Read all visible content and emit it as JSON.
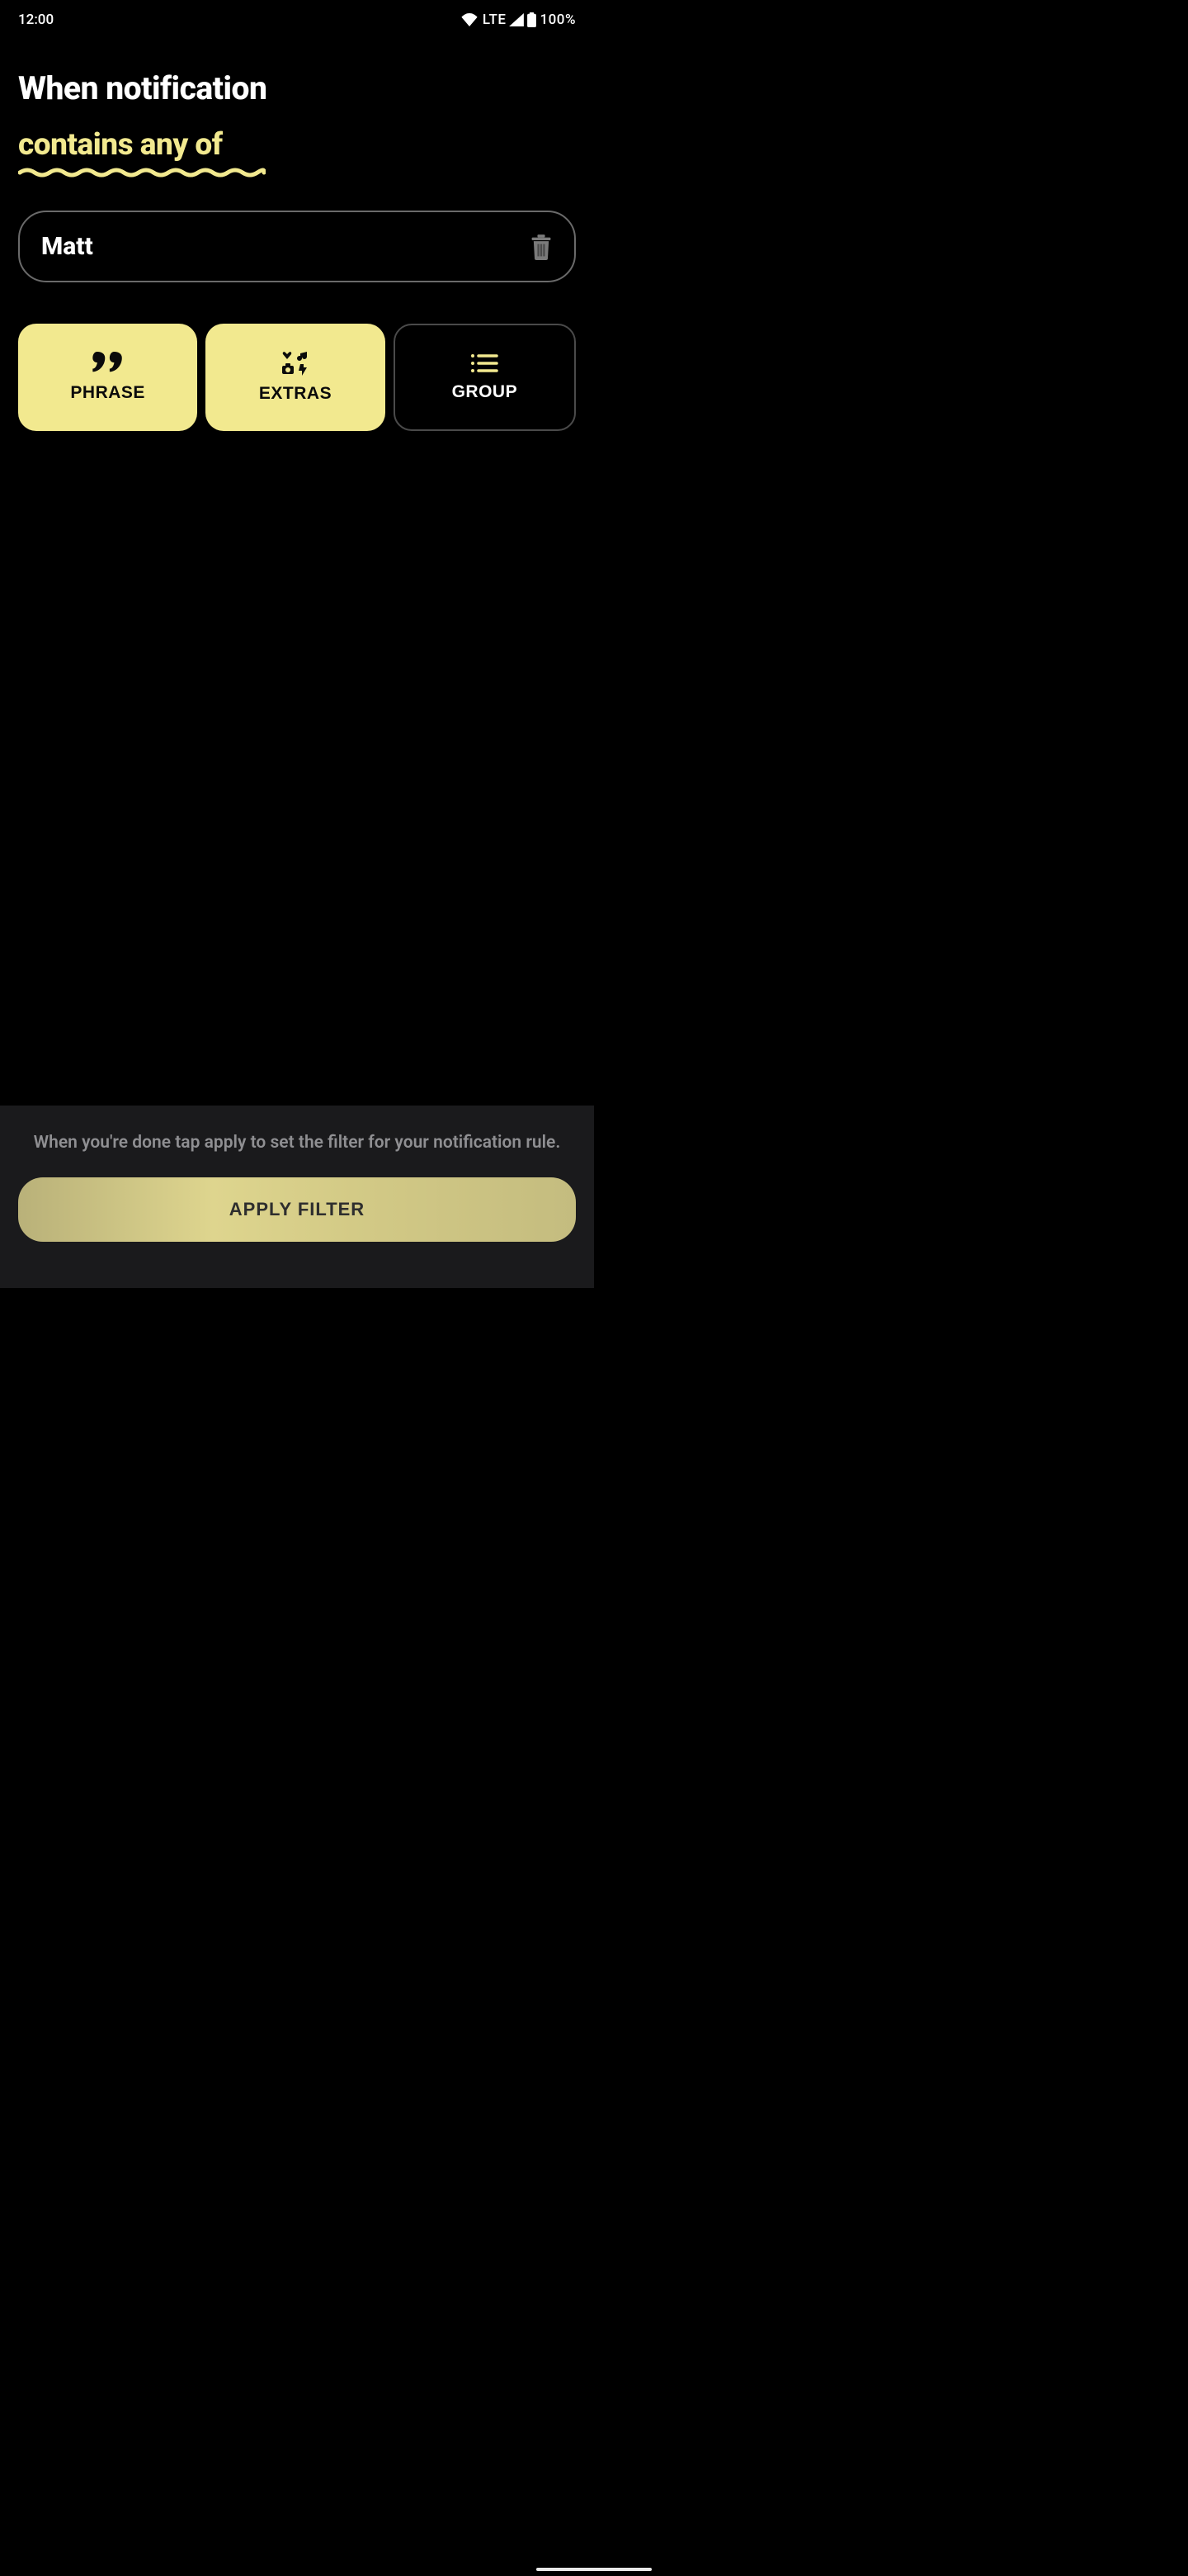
{
  "status": {
    "time": "12:00",
    "network": "LTE",
    "battery": "100%"
  },
  "header": {
    "title": "When notification",
    "subtitle": "contains any of"
  },
  "chip": {
    "value": "Matt"
  },
  "filters": {
    "phrase": "PHRASE",
    "extras": "EXTRAS",
    "group": "GROUP"
  },
  "footer": {
    "hint": "When you're done tap apply to set the filter for your notification rule.",
    "apply": "APPLY FILTER"
  },
  "colors": {
    "accent": "#f2e98f"
  }
}
